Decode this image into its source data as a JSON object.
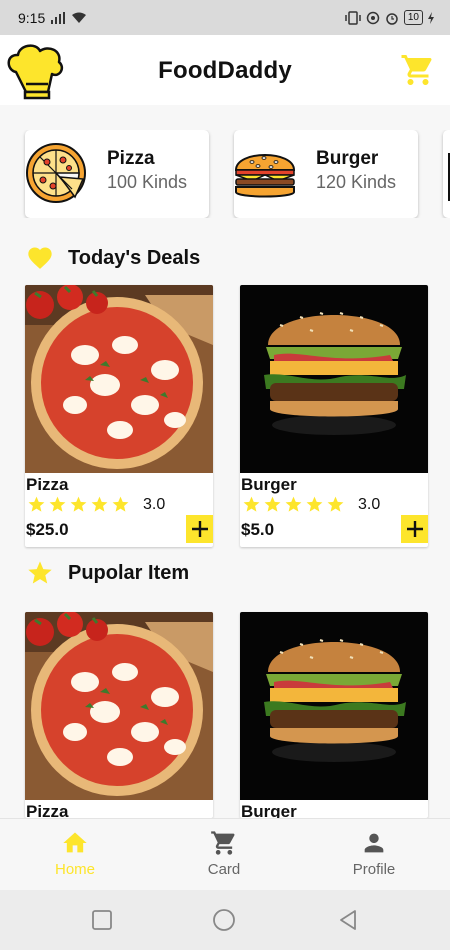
{
  "status_bar": {
    "time": "9:15",
    "battery": "10"
  },
  "header": {
    "title": "FoodDaddy"
  },
  "categories": [
    {
      "name": "Pizza",
      "count": "100 Kinds",
      "icon": "pizza-icon"
    },
    {
      "name": "Burger",
      "count": "120 Kinds",
      "icon": "burger-icon"
    }
  ],
  "sections": {
    "deals_title": "Today's Deals",
    "popular_title": "Pupolar Item"
  },
  "deals": [
    {
      "name": "Pizza",
      "rating": "3.0",
      "stars": 5,
      "price": "$25.0"
    },
    {
      "name": "Burger",
      "rating": "3.0",
      "stars": 5,
      "price": "$5.0"
    }
  ],
  "popular": [
    {
      "name": "Pizza"
    },
    {
      "name": "Burger"
    }
  ],
  "bottom_nav": [
    {
      "label": "Home",
      "icon": "home-icon",
      "active": true
    },
    {
      "label": "Card",
      "icon": "cart-icon",
      "active": false
    },
    {
      "label": "Profile",
      "icon": "person-icon",
      "active": false
    }
  ],
  "colors": {
    "accent": "#fde52c",
    "text": "#111111",
    "muted": "#666666"
  }
}
